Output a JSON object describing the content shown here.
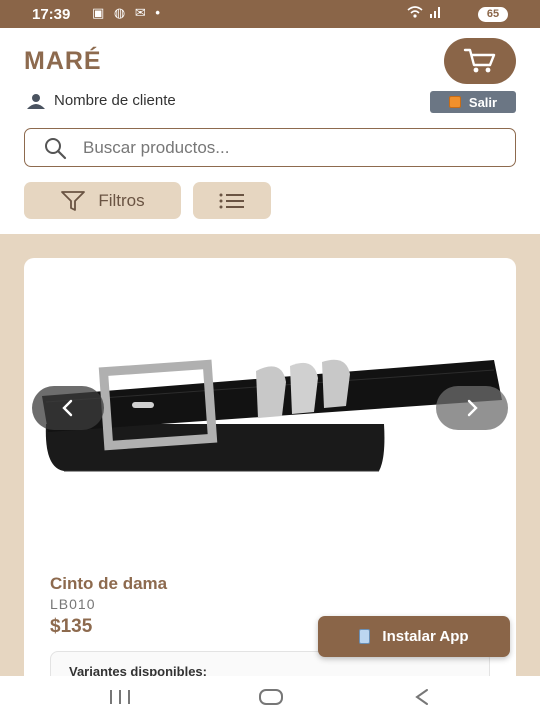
{
  "status_bar": {
    "time": "17:39",
    "left_icons": [
      "screenshot-icon",
      "globe-icon",
      "gmail-icon",
      "dot-icon"
    ],
    "right_icons": [
      "wifi-icon",
      "signal-icon"
    ],
    "battery": "65"
  },
  "header": {
    "brand": "MARÉ",
    "client_name": "Nombre de cliente",
    "logout_label": "Salir",
    "search_placeholder": "Buscar productos...",
    "filter_label": "Filtros"
  },
  "product": {
    "name": "Cinto de dama",
    "code": "LB010",
    "price": "$135",
    "variants_title": "Variantes disponibles:"
  },
  "install_label": "Instalar App",
  "colors": {
    "brand": "#8d6a4e",
    "status_bar": "#8a6548",
    "background": "#e6d6c1",
    "logout": "#6b7684"
  }
}
